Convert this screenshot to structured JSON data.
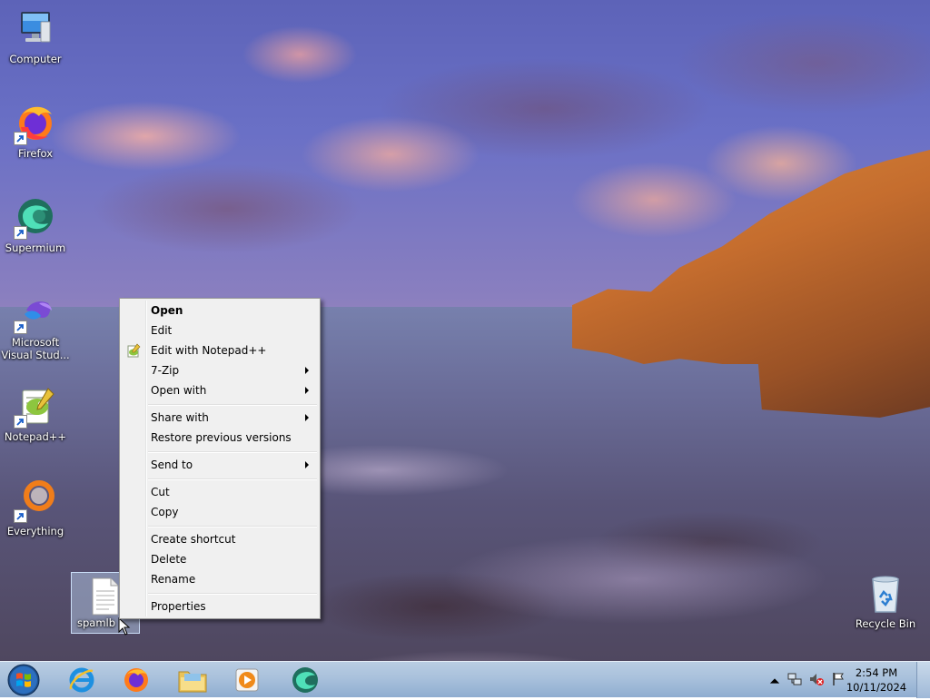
{
  "desktop": {
    "icons": [
      {
        "label_lines": [
          "Computer"
        ]
      },
      {
        "label_lines": [
          "Firefox"
        ]
      },
      {
        "label_lines": [
          "Supermium"
        ]
      },
      {
        "label_lines": [
          "Microsoft",
          "Visual Stud..."
        ]
      },
      {
        "label_lines": [
          "Notepad++"
        ]
      },
      {
        "label_lines": [
          "Everything"
        ]
      },
      {
        "label_lines": [
          "spamlb"
        ]
      },
      {
        "label_lines": [
          "Recycle Bin"
        ]
      }
    ]
  },
  "context_menu": {
    "items": [
      {
        "label": "Open",
        "bold": true
      },
      {
        "label": "Edit"
      },
      {
        "label": "Edit with Notepad++",
        "icon": "notepadpp-icon"
      },
      {
        "label": "7-Zip",
        "submenu": true
      },
      {
        "label": "Open with",
        "submenu": true
      },
      {
        "label": "Share with",
        "submenu": true
      },
      {
        "label": "Restore previous versions"
      },
      {
        "label": "Send to",
        "submenu": true
      },
      {
        "label": "Cut"
      },
      {
        "label": "Copy"
      },
      {
        "label": "Create shortcut"
      },
      {
        "label": "Delete"
      },
      {
        "label": "Rename"
      },
      {
        "label": "Properties"
      }
    ]
  },
  "taskbar": {
    "pinned": [
      "start-button",
      "internet-explorer",
      "firefox",
      "file-explorer",
      "media-player",
      "supermium"
    ],
    "tray_icons": [
      "show-hidden-icons",
      "network-icon",
      "volume-muted-icon",
      "action-center-flag-icon"
    ],
    "clock": {
      "time": "2:54 PM",
      "date": "10/11/2024"
    }
  },
  "colors": {
    "menu_bg": "#f0f0f0",
    "taskbar_top": "#b9cde2",
    "taskbar_bottom": "#8fadd0"
  }
}
